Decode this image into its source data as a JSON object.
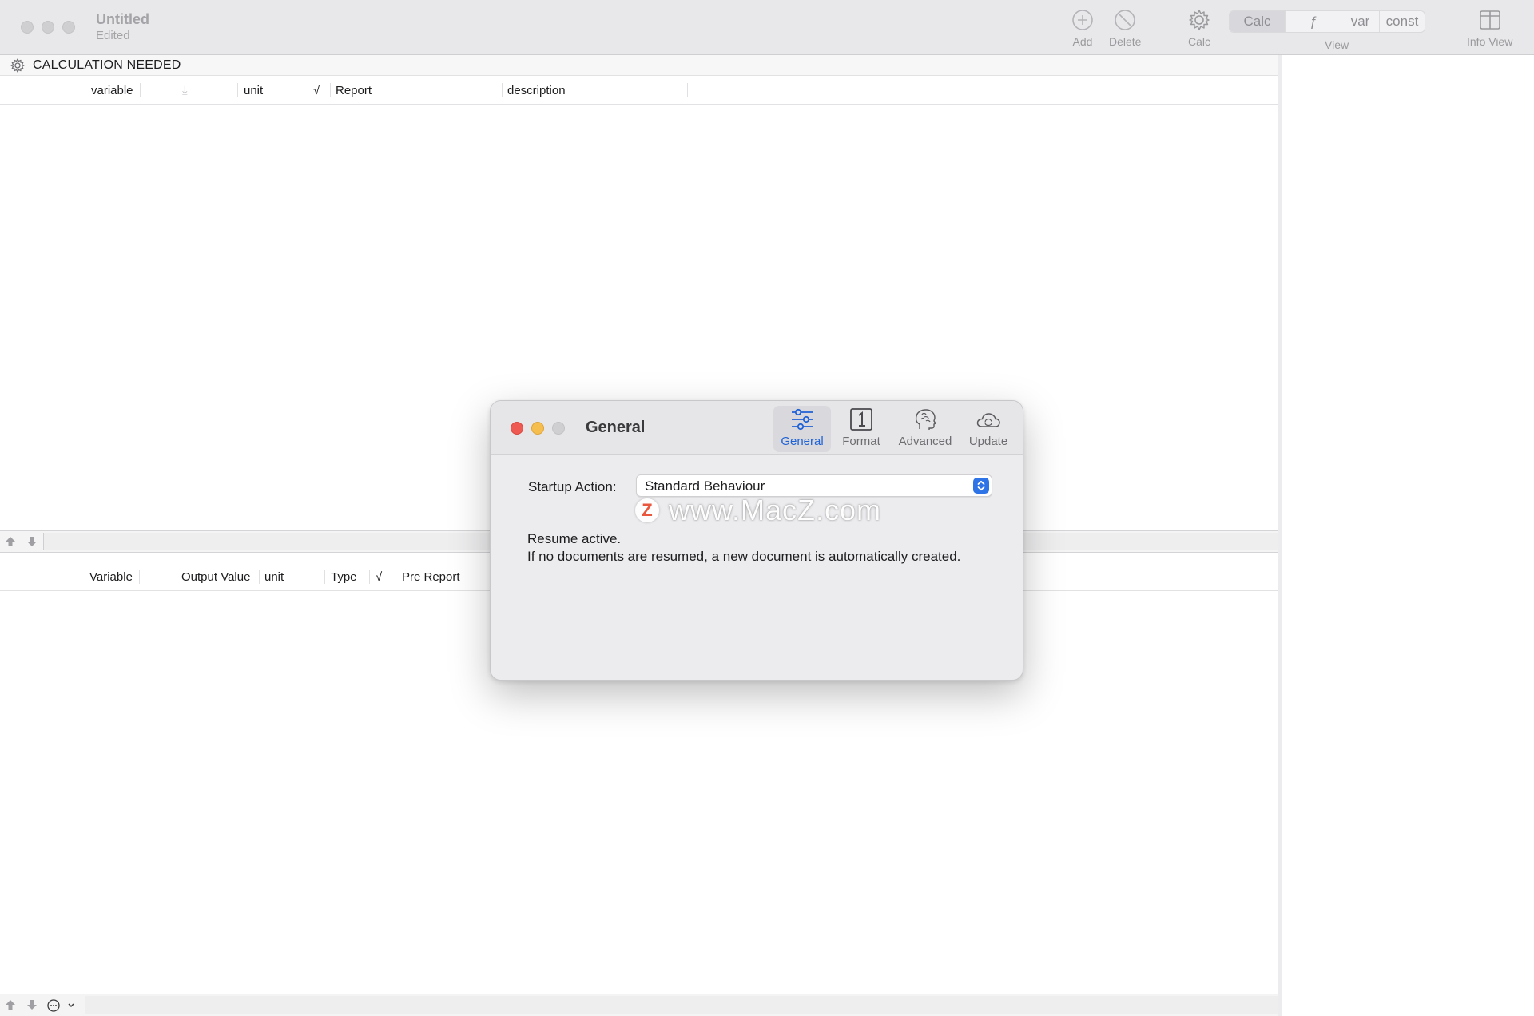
{
  "window": {
    "title": "Untitled",
    "subtitle": "Edited"
  },
  "toolbar": {
    "add_label": "Add",
    "delete_label": "Delete",
    "calc_label": "Calc",
    "view_label": "View",
    "info_view_label": "Info View",
    "view_segments": [
      "Calc",
      "ƒ",
      "var",
      "const"
    ]
  },
  "status": {
    "text": "CALCULATION NEEDED"
  },
  "input_table": {
    "columns": [
      "variable",
      "⤓",
      "unit",
      "√",
      "Report",
      "description"
    ]
  },
  "output_table": {
    "columns": [
      "Variable",
      "Output Value",
      "unit",
      "Type",
      "√",
      "Pre Report"
    ]
  },
  "dialog": {
    "title": "General",
    "tabs": [
      "General",
      "Format",
      "Advanced",
      "Update"
    ],
    "active_tab": "General",
    "startup_label": "Startup Action:",
    "startup_value": "Standard Behaviour",
    "info_line1": "Resume active.",
    "info_line2": "If no documents are resumed, a new document is automatically created."
  },
  "watermark": {
    "logo": "Z",
    "text": "www.MacZ.com"
  },
  "colors": {
    "accent": "#1f62d6",
    "close": "#ee5a52",
    "minimize": "#f5be4f",
    "stepper": "#2f74e6"
  }
}
